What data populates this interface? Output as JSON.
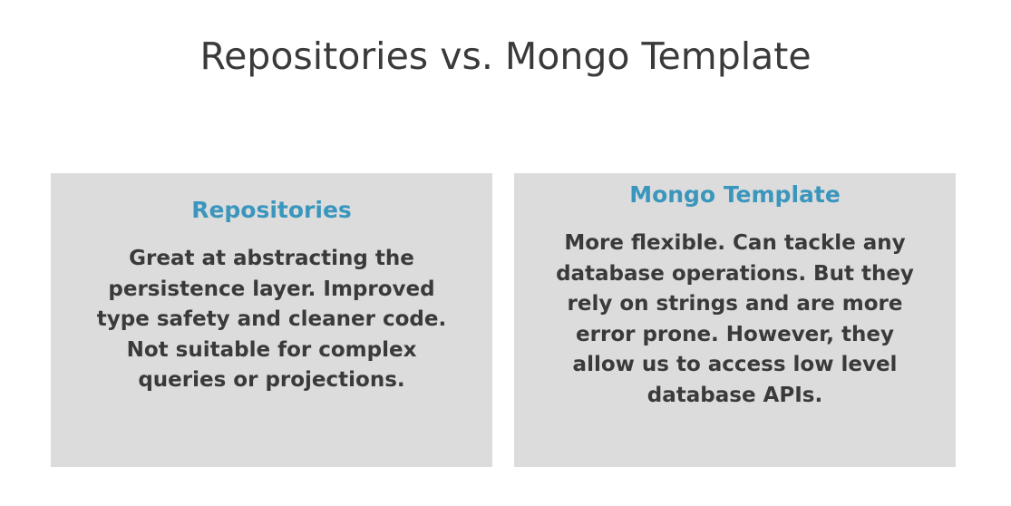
{
  "slide": {
    "title": "Repositories vs. Mongo Template"
  },
  "cards": [
    {
      "heading": "Repositories",
      "lines": [
        "Great at abstracting the",
        "persistence layer. Improved",
        "type safety and cleaner code.",
        "Not suitable for complex",
        "queries or projections."
      ]
    },
    {
      "heading": "Mongo Template",
      "lines": [
        "More flexible. Can tackle any",
        "database operations. But they",
        "rely on strings and are more",
        "error prone. However, they",
        "allow us to access low level",
        "database APIs."
      ]
    }
  ],
  "colors": {
    "heading_accent": "#3a96bd",
    "text": "#3a3a3a",
    "card_background": "#dcdcdc"
  }
}
